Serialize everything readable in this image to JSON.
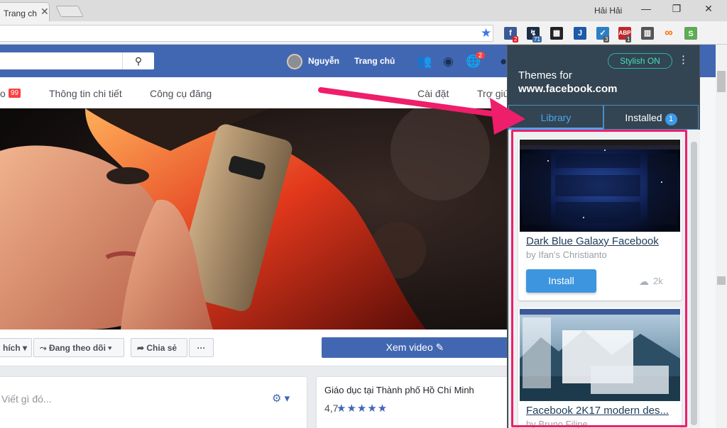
{
  "browser": {
    "tab_title": "Trang ch",
    "profile_name": "Hải Hải",
    "window_controls": [
      "minimize-icon",
      "restore-icon",
      "close-icon"
    ],
    "extensions": [
      {
        "icon": "facebook-ext-icon",
        "badge": "2",
        "color": "#3b5998"
      },
      {
        "icon": "ext-71-icon",
        "badge": "71",
        "color": "#1c2e45"
      },
      {
        "icon": "film-icon",
        "badge": "",
        "color": "#222222"
      },
      {
        "icon": "j-icon",
        "badge": "",
        "color": "#1d5aa8"
      },
      {
        "icon": "shield-icon",
        "badge": "3",
        "color": "#2c7fc4"
      },
      {
        "icon": "abp-icon",
        "badge": "1",
        "color": "#c0272d"
      },
      {
        "icon": "trello-icon",
        "badge": "",
        "color": "#555555"
      },
      {
        "icon": "infinity-icon",
        "badge": "",
        "color": "#ff6b00"
      },
      {
        "icon": "stylish-icon",
        "badge": "",
        "color": "#57b14a"
      }
    ]
  },
  "facebook": {
    "user_name": "Nguyễn",
    "home_label": "Trang chủ",
    "notifications_badge": "2",
    "nav": {
      "first_suffix": "o",
      "first_badge": "99",
      "items": [
        "Thông tin chi tiết",
        "Công cụ đăng",
        "Cài đặt",
        "Trợ giú"
      ]
    },
    "actions": {
      "like_label": "hích",
      "follow_label": "Đang theo dõi",
      "share_label": "Chia sẻ",
      "more_label": "···",
      "video_label": "Xem video"
    },
    "composer_placeholder": "Viết gì đó...",
    "education": {
      "title": "Giáo dục tại Thành phố Hồ Chí Minh",
      "rating": "4,7",
      "stars": "★★★★★"
    }
  },
  "stylish": {
    "toggle_label": "Stylish ON",
    "title": "Themes for",
    "domain": "www.facebook.com",
    "tabs": {
      "library": "Library",
      "installed": "Installed",
      "installed_count": "1"
    },
    "themes": [
      {
        "name": "Dark Blue Galaxy Facebook",
        "author": "by Ifan's Christianto",
        "install_label": "Install",
        "downloads": "2k"
      },
      {
        "name": "Facebook 2K17 modern des...",
        "author": "by Bruno Filipe"
      }
    ]
  },
  "colors": {
    "facebook_blue": "#4267b2",
    "stylish_panel": "#334452",
    "highlight": "#ef1e6a",
    "install_blue": "#3d95e0"
  }
}
